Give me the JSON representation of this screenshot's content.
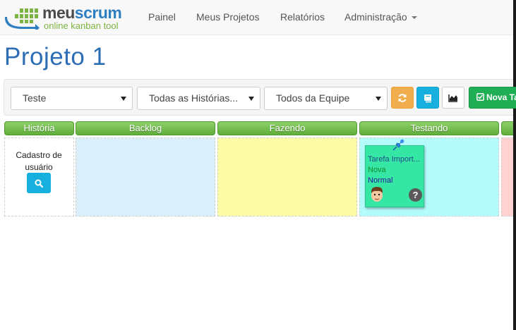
{
  "brand": {
    "name_part1": "meu",
    "name_part2": "scrum",
    "tagline": "online kanban tool",
    "colors": {
      "blue": "#2d7fc1",
      "green": "#7cb342"
    }
  },
  "nav": {
    "items": [
      {
        "label": "Painel"
      },
      {
        "label": "Meus Projetos"
      },
      {
        "label": "Relatórios"
      },
      {
        "label": "Administração",
        "has_dropdown": true
      }
    ]
  },
  "page": {
    "title": "Projeto 1"
  },
  "toolbar": {
    "filters": [
      {
        "selected": "Teste"
      },
      {
        "selected": "Todas as Histórias..."
      },
      {
        "selected": "Todos da Equipe"
      }
    ],
    "buttons": [
      {
        "icon": "refresh-icon",
        "color": "#f0ad4e"
      },
      {
        "icon": "book-icon",
        "color": "#17b0de"
      },
      {
        "icon": "chart-icon",
        "color": "#ffffff"
      }
    ],
    "new_task_label": "Nova Ta",
    "new_task_icon": "check-square-icon"
  },
  "board": {
    "header_color": "#6ebe46",
    "columns": [
      {
        "label": "História",
        "bg": "#ffffff"
      },
      {
        "label": "Backlog",
        "bg": "#d9f0fb"
      },
      {
        "label": "Fazendo",
        "bg": "#fdfca6"
      },
      {
        "label": "Testando",
        "bg": "#b4fbfb"
      },
      {
        "label": "",
        "bg": "#ffd2d2"
      }
    ],
    "story": {
      "title": "Cadastro de usuário"
    },
    "task": {
      "title": "Tarefa Import...",
      "status": "Nova",
      "priority": "Normal",
      "color": "#35e6a4",
      "help_symbol": "?"
    }
  }
}
